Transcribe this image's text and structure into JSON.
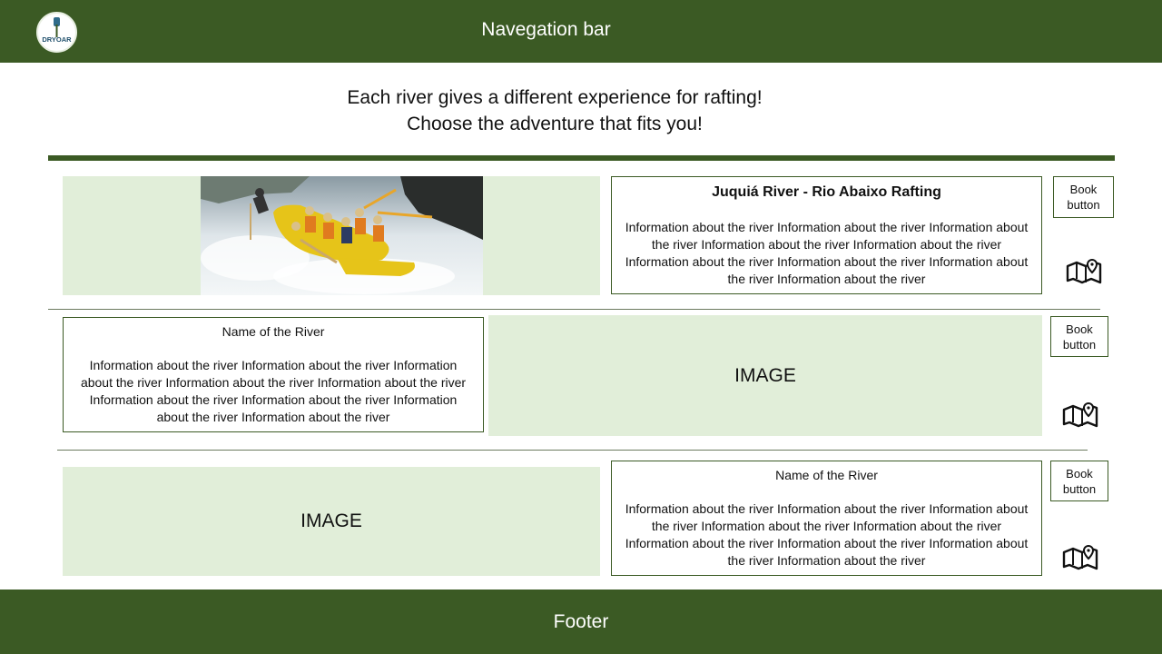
{
  "navbar": {
    "logo_text": "DRYOAR",
    "title": "Navegation bar"
  },
  "headline": {
    "line1": "Each river gives a different experience for rafting!",
    "line2": "Choose the adventure that fits you!"
  },
  "rivers": [
    {
      "name": "Juquiá River - Rio Abaixo Rafting",
      "info": "Information about the river Information about the river Information about the river Information about the river Information about the river Information about the river Information about the river Information about the river Information about the river",
      "book_label": "Book button",
      "map_icon": "map-pin-icon"
    },
    {
      "name": "Name of the River",
      "info": "Information about the river Information about the river Information about the river Information about the river Information about the river Information about the river Information about the river Information about the river Information about the river",
      "image_label": "IMAGE",
      "book_label": "Book button",
      "map_icon": "map-pin-icon"
    },
    {
      "name": "Name of the River",
      "info": "Information about the river Information about the river Information about the river Information about the river Information about the river Information about the river Information about the river Information about the river Information about the river",
      "image_label": "IMAGE",
      "book_label": "Book button",
      "map_icon": "map-pin-icon"
    }
  ],
  "footer": {
    "text": "Footer"
  },
  "colors": {
    "brand_green": "#3b5a24",
    "image_placeholder": "#e1eed9"
  }
}
